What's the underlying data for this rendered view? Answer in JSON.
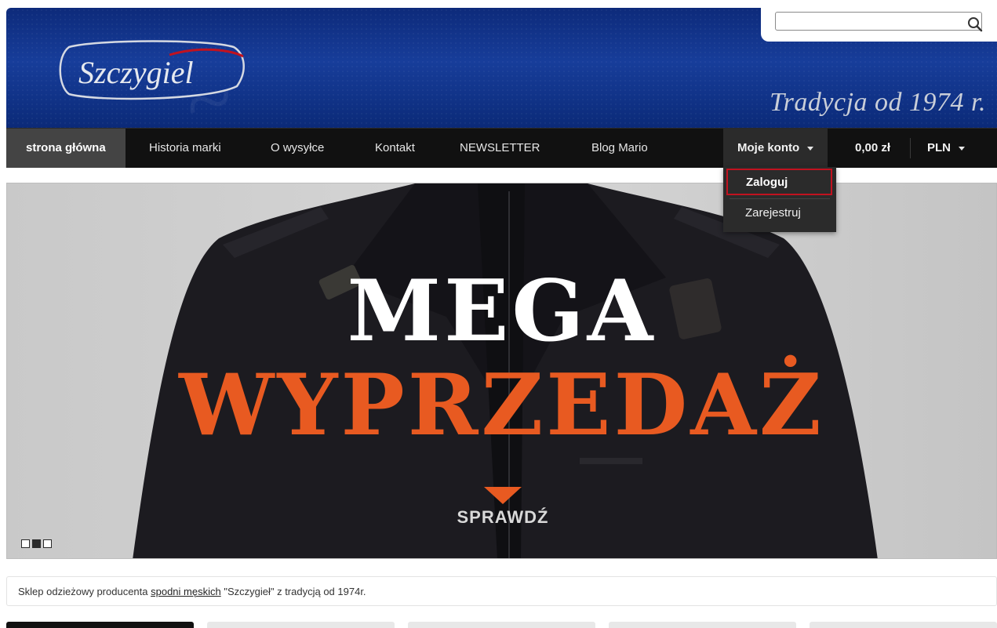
{
  "search": {
    "placeholder": "",
    "value": ""
  },
  "logo": {
    "text": "Szczygiel"
  },
  "tagline": "Tradycja od 1974 r.",
  "nav": {
    "items": [
      "strona główna",
      "Historia marki",
      "O wysyłce",
      "Kontakt",
      "NEWSLETTER",
      "Blog Mario"
    ],
    "account": "Moje konto",
    "cart_total": "0,00 zł",
    "currency": "PLN"
  },
  "account_menu": {
    "items": [
      "Zaloguj",
      "Zarejestruj"
    ]
  },
  "hero": {
    "title_line1": "MEGA",
    "title_line2": "WYPRZEDAŻ",
    "cta": "SPRAWDŹ",
    "slides_total": 3,
    "slide_active": 2,
    "accent_color": "#e85a21"
  },
  "info": {
    "prefix": "Sklep odzieżowy producenta ",
    "link": "spodni męskich",
    "suffix": " \"Szczygieł\" z tradycją od 1974r."
  },
  "colors": {
    "header_blue": "#173d9a",
    "nav_bg": "#111111",
    "highlight_border": "#c1121f"
  }
}
